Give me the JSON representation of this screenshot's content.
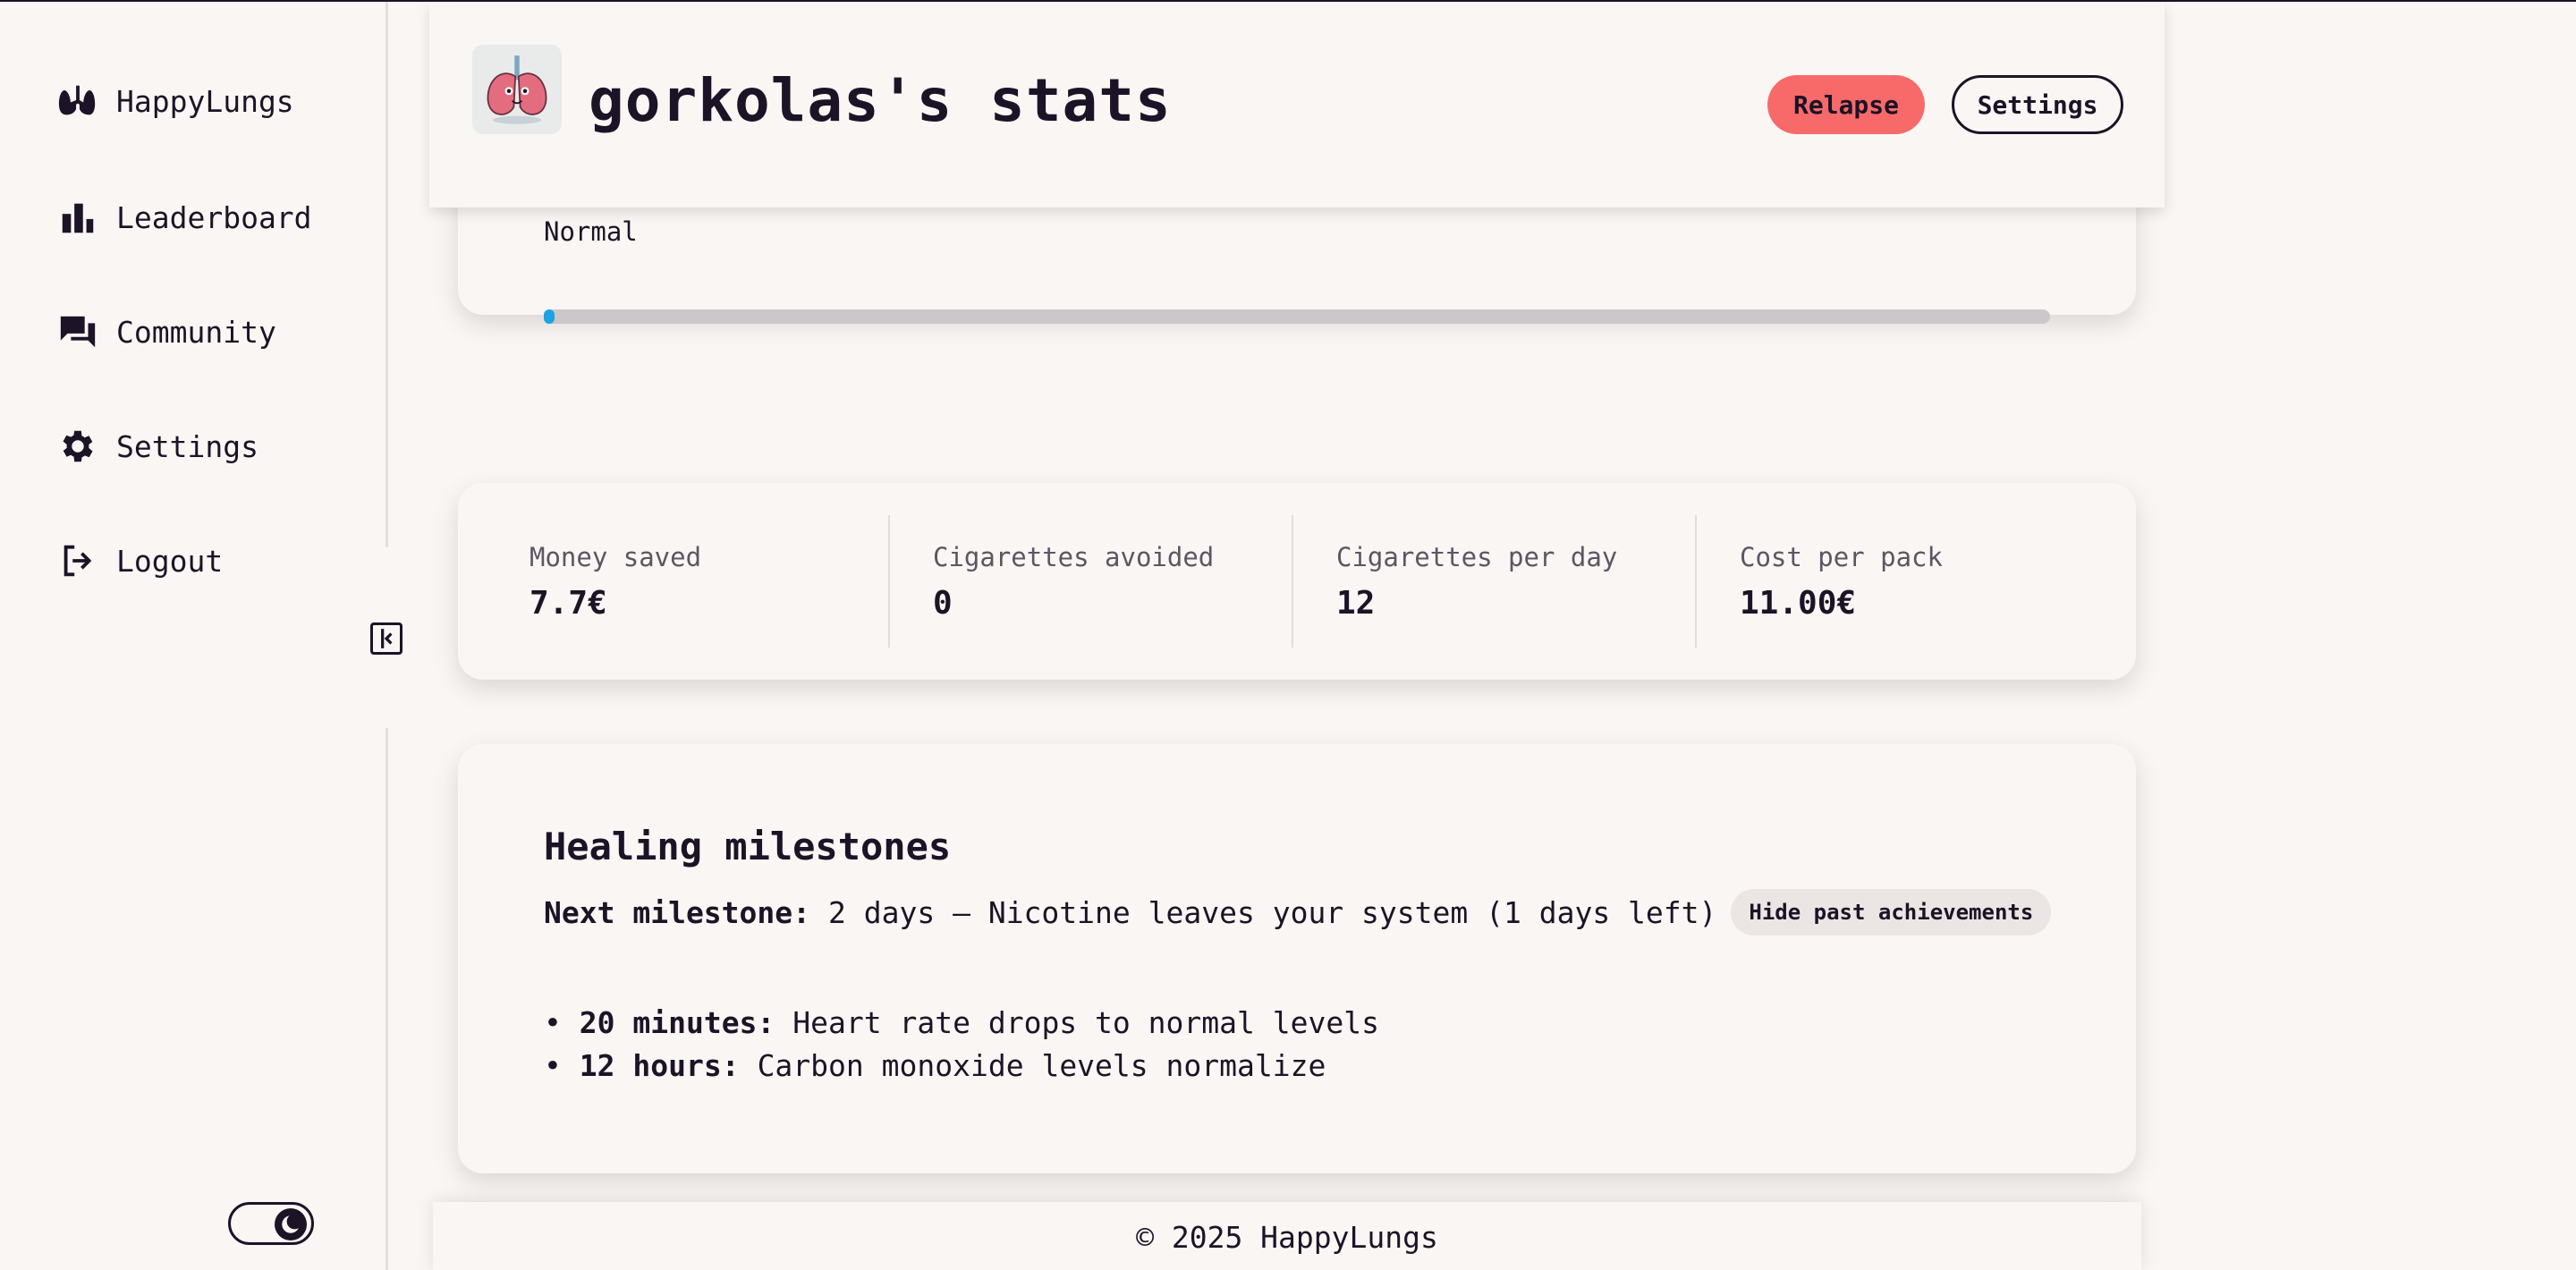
{
  "sidebar": {
    "items": [
      {
        "label": "HappyLungs",
        "icon": "lungs-icon"
      },
      {
        "label": "Leaderboard",
        "icon": "bar-chart-icon"
      },
      {
        "label": "Community",
        "icon": "chat-bubbles-icon"
      },
      {
        "label": "Settings",
        "icon": "gear-icon"
      },
      {
        "label": "Logout",
        "icon": "logout-icon"
      }
    ],
    "collapse_icon": "sidebar-collapse-icon",
    "theme_toggle_icon": "moon-icon"
  },
  "header": {
    "title": "gorkolas's stats",
    "relapse_label": "Relapse",
    "settings_label": "Settings",
    "accent_relapse": "#f86a6a"
  },
  "progress": {
    "status": "Normal",
    "fraction": 0.007,
    "fill_color": "#1ba3e4"
  },
  "stats": [
    {
      "label": "Money saved",
      "value": "7.7€"
    },
    {
      "label": "Cigarettes avoided",
      "value": "0"
    },
    {
      "label": "Cigarettes per day",
      "value": "12"
    },
    {
      "label": "Cost per pack",
      "value": "11.00€"
    }
  ],
  "milestones": {
    "title": "Healing milestones",
    "next_label": "Next milestone:",
    "next_text": "2 days — Nicotine leaves your system (1 days left)",
    "hide_button": "Hide past achievements",
    "past": [
      {
        "time": "20 minutes:",
        "text": "Heart rate drops to normal levels"
      },
      {
        "time": "12 hours:",
        "text": "Carbon monoxide levels normalize"
      }
    ]
  },
  "footer": {
    "text": "© 2025 HappyLungs"
  }
}
